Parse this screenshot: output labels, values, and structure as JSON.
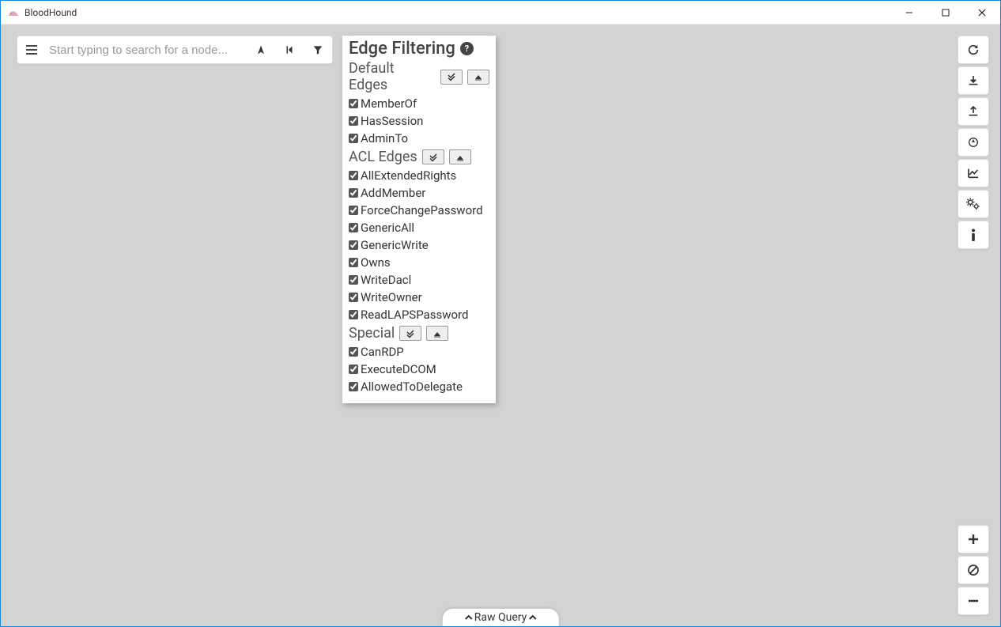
{
  "window": {
    "title": "BloodHound"
  },
  "search": {
    "placeholder": "Start typing to search for a node..."
  },
  "filterPanel": {
    "title": "Edge Filtering",
    "sections": [
      {
        "name": "Default Edges",
        "items": [
          "MemberOf",
          "HasSession",
          "AdminTo"
        ]
      },
      {
        "name": "ACL Edges",
        "items": [
          "AllExtendedRights",
          "AddMember",
          "ForceChangePassword",
          "GenericAll",
          "GenericWrite",
          "Owns",
          "WriteDacl",
          "WriteOwner",
          "ReadLAPSPassword"
        ]
      },
      {
        "name": "Special",
        "items": [
          "CanRDP",
          "ExecuteDCOM",
          "AllowedToDelegate"
        ]
      }
    ]
  },
  "rawQuery": {
    "label": "Raw Query"
  }
}
